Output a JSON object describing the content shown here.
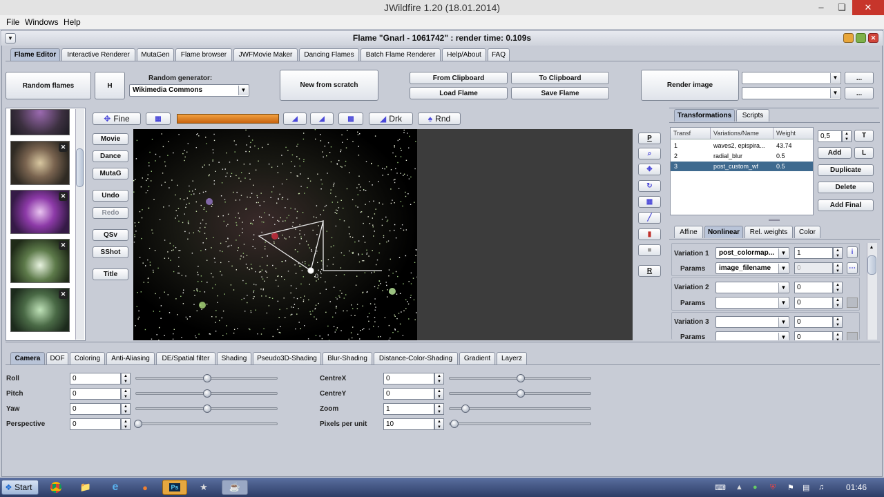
{
  "window": {
    "title": "JWildfire 1.20 (18.01.2014)"
  },
  "menu": {
    "items": [
      "File",
      "Windows",
      "Help"
    ]
  },
  "flame_window": {
    "title": "Flame \"Gnarl - 1061742\" : render time: 0.109s"
  },
  "main_tabs": [
    "Flame Editor",
    "Interactive Renderer",
    "MutaGen",
    "Flame browser",
    "JWFMovie Maker",
    "Dancing Flames",
    "Batch Flame Renderer",
    "Help/About",
    "FAQ"
  ],
  "toolbar": {
    "random_flames": "Random flames",
    "h_button": "H",
    "random_generator_label": "Random generator:",
    "random_generator_value": "Wikimedia Commons",
    "new_from_scratch": "New from scratch",
    "from_clipboard": "From Clipboard",
    "to_clipboard": "To Clipboard",
    "load_flame": "Load Flame",
    "save_flame": "Save Flame",
    "render_image": "Render image",
    "ellipsis": "..."
  },
  "edit_toolbar": {
    "fine": "Fine",
    "drk": "Drk",
    "rnd": "Rnd"
  },
  "left_buttons": {
    "movie": "Movie",
    "dance": "Dance",
    "mutag": "MutaG",
    "undo": "Undo",
    "redo": "Redo",
    "qsv": "QSv",
    "sshot": "SShot",
    "title": "Title"
  },
  "right_tool_buttons": {
    "p": "P",
    "r": "R"
  },
  "canvas": {
    "origin_label": "0"
  },
  "transform_tabs": [
    "Transformations",
    "Scripts"
  ],
  "transform_table": {
    "headers": [
      "Transf",
      "Variations/Name",
      "Weight"
    ],
    "rows": [
      {
        "id": "1",
        "name": "waves2, epispira...",
        "weight": "43.74"
      },
      {
        "id": "2",
        "name": "radial_blur",
        "weight": "0.5"
      },
      {
        "id": "3",
        "name": "post_custom_wf",
        "weight": "0.5"
      }
    ]
  },
  "transform_buttons": {
    "step_value": "0,5",
    "t": "T",
    "add": "Add",
    "l": "L",
    "duplicate": "Duplicate",
    "delete": "Delete",
    "add_final": "Add Final"
  },
  "sub_tabs": [
    "Affine",
    "Nonlinear",
    "Rel. weights",
    "Color"
  ],
  "variations": [
    {
      "label": "Variation 1",
      "value": "post_colormap...",
      "amount": "1",
      "params_label": "Params",
      "param_name": "image_filename",
      "param_value": "0"
    },
    {
      "label": "Variation 2",
      "value": "",
      "amount": "0",
      "params_label": "Params",
      "param_name": "",
      "param_value": "0"
    },
    {
      "label": "Variation 3",
      "value": "",
      "amount": "0",
      "params_label": "Params",
      "param_name": "",
      "param_value": "0"
    }
  ],
  "bottom_tabs": [
    "Camera",
    "DOF",
    "Coloring",
    "Anti-Aliasing",
    "DE/Spatial filter",
    "Shading",
    "Pseudo3D-Shading",
    "Blur-Shading",
    "Distance-Color-Shading",
    "Gradient",
    "Layerz"
  ],
  "camera_left": [
    {
      "label": "Roll",
      "value": "0",
      "slider": 0.5
    },
    {
      "label": "Pitch",
      "value": "0",
      "slider": 0.5
    },
    {
      "label": "Yaw",
      "value": "0",
      "slider": 0.5
    },
    {
      "label": "Perspective",
      "value": "0",
      "slider": 0.0
    }
  ],
  "camera_right": [
    {
      "label": "CentreX",
      "value": "0",
      "slider": 0.5
    },
    {
      "label": "CentreY",
      "value": "0",
      "slider": 0.5
    },
    {
      "label": "Zoom",
      "value": "1",
      "slider": 0.1
    },
    {
      "label": "Pixels per unit",
      "value": "10",
      "slider": 0.02
    }
  ],
  "taskbar": {
    "start": "Start",
    "clock": "01:46"
  }
}
